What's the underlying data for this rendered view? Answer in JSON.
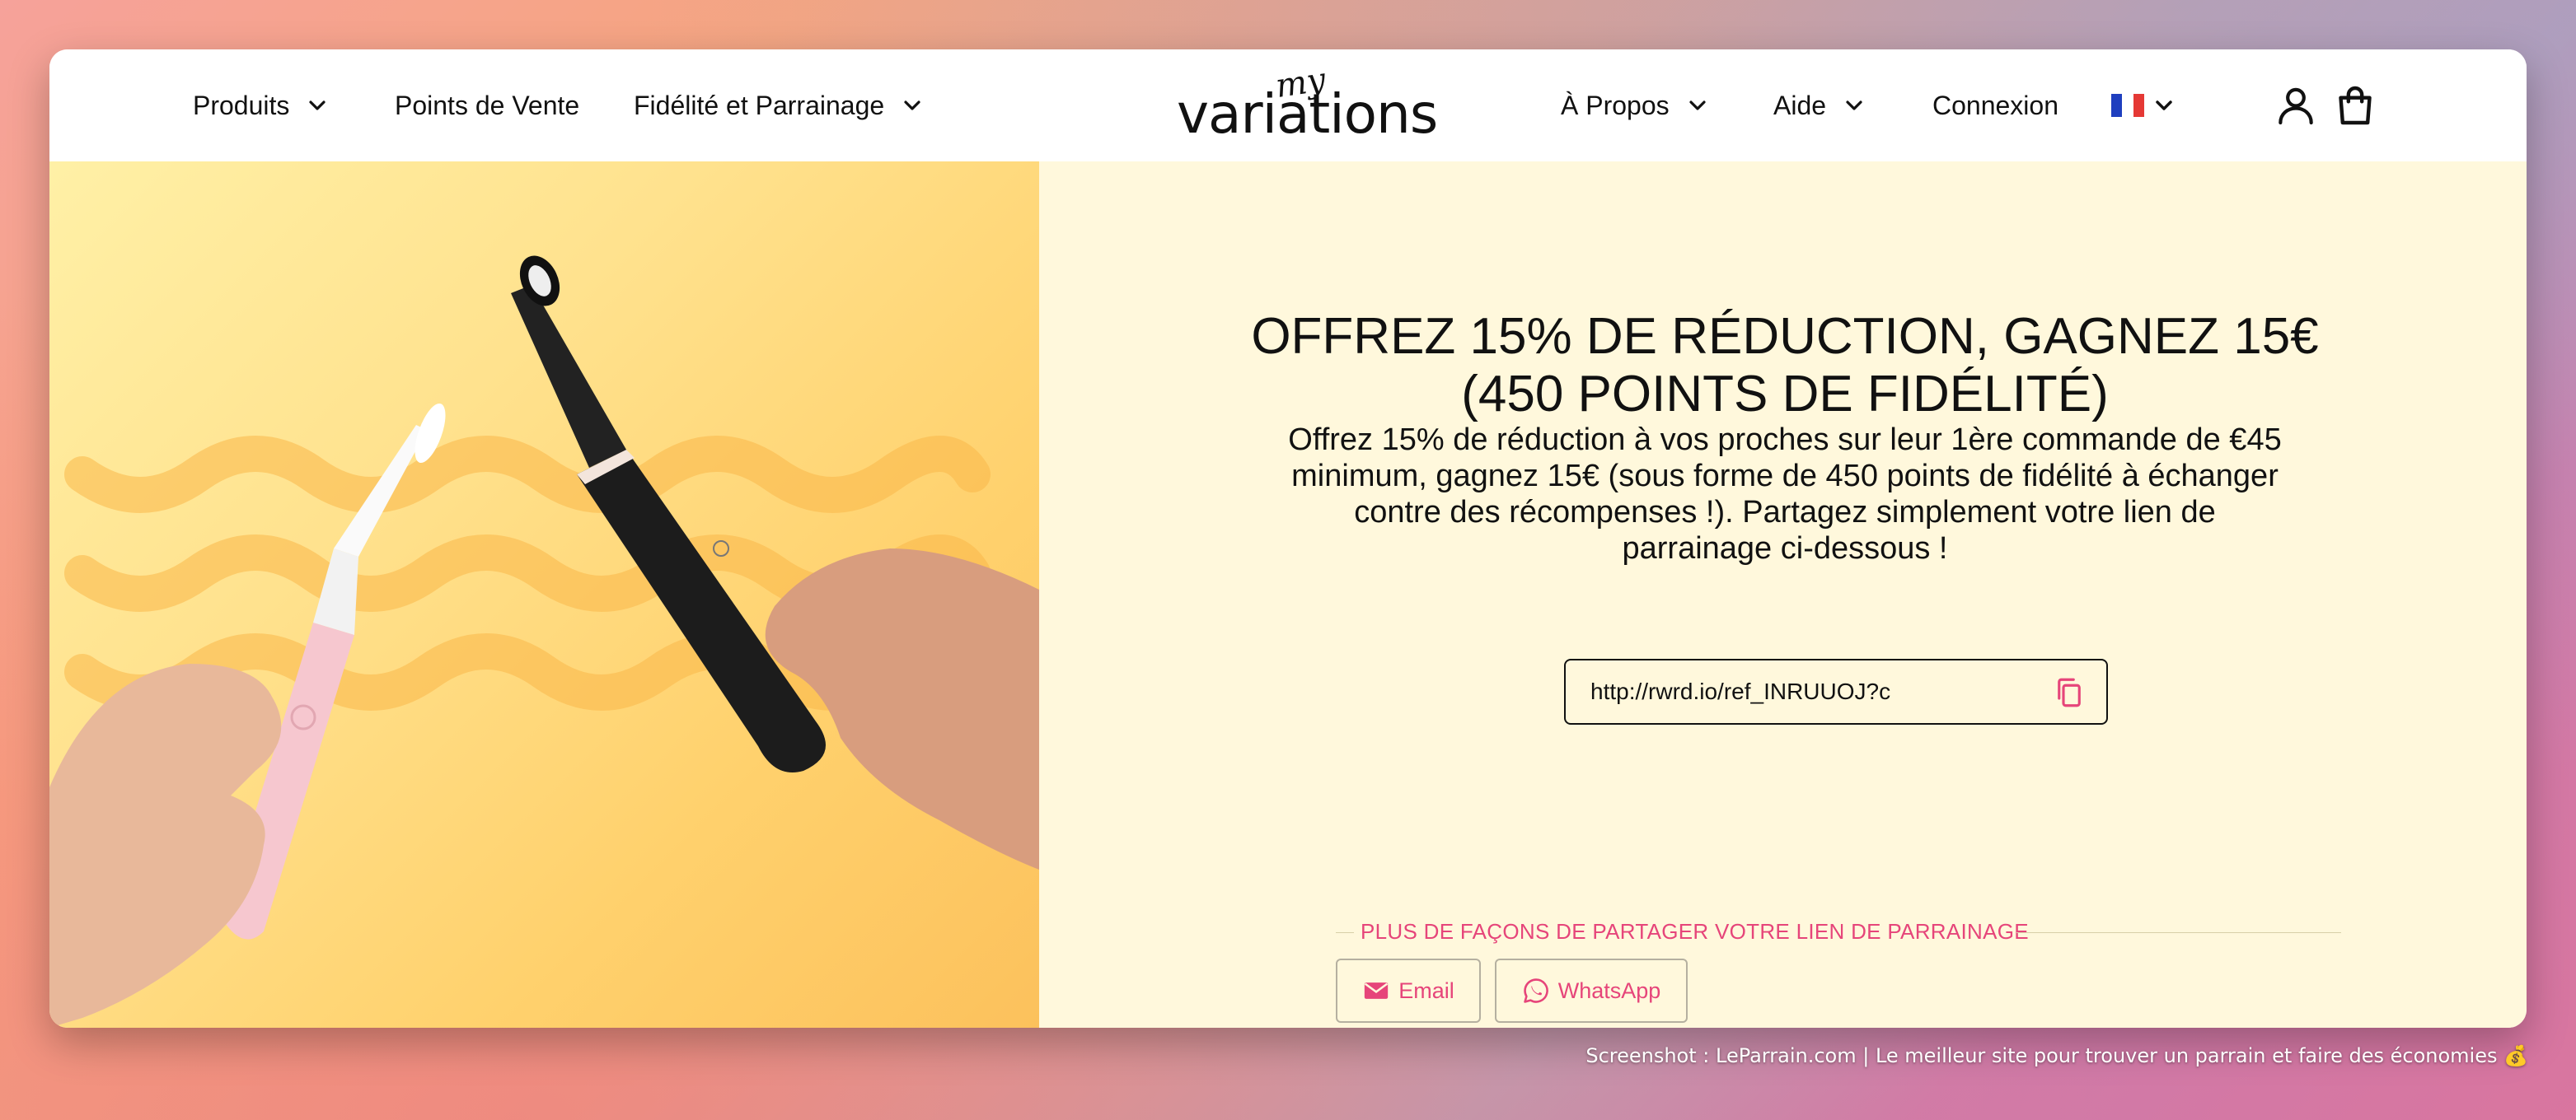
{
  "header": {
    "nav_left": [
      {
        "label": "Produits",
        "has_dropdown": true
      },
      {
        "label": "Points de Vente",
        "has_dropdown": false
      },
      {
        "label": "Fidélité et Parrainage",
        "has_dropdown": true
      }
    ],
    "logo": {
      "small": "my",
      "main": "variations"
    },
    "nav_right": [
      {
        "label": "À Propos",
        "has_dropdown": true
      },
      {
        "label": "Aide",
        "has_dropdown": true
      },
      {
        "label": "Connexion",
        "has_dropdown": false
      }
    ],
    "language": {
      "flag": "fr-flag-icon",
      "has_dropdown": true
    },
    "icons": [
      "account-icon",
      "cart-icon"
    ]
  },
  "hero": {
    "image_alt_icon": "toothbrush-photo"
  },
  "referral": {
    "headline": "OFFREZ 15% DE RÉDUCTION, GAGNEZ 15€ (450 POINTS DE FIDÉLITÉ)",
    "description": "Offrez 15% de réduction à vos proches sur leur 1ère commande de €45 minimum, gagnez 15€ (sous forme de 450 points de fidélité à échanger contre des récompenses !). Partagez simplement votre lien de parrainage ci-dessous !",
    "link_value": "http://rwrd.io/ref_INRUUOJ?c",
    "share_title": "PLUS DE FAÇONS DE PARTAGER VOTRE LIEN DE PARRAINAGE",
    "share_buttons": [
      {
        "label": "Email",
        "icon": "envelope-icon"
      },
      {
        "label": "WhatsApp",
        "icon": "whatsapp-icon"
      }
    ]
  },
  "caption": "Screenshot : LeParrain.com | Le meilleur site pour trouver un parrain et faire des économies 💰",
  "colors": {
    "accent": "#e6457a",
    "panel_bg": "#fff8dc",
    "hero_bg": "#ffd16d",
    "flag_blue": "#1f3fbf",
    "flag_red": "#e53935"
  }
}
